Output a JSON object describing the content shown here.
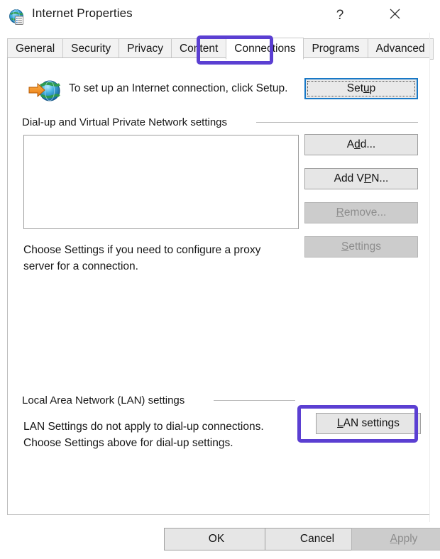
{
  "window": {
    "title": "Internet Properties",
    "icon": "internet-properties-globe-icon",
    "help_label": "?",
    "close_label": "✕"
  },
  "tabs": [
    {
      "label": "General",
      "selected": false
    },
    {
      "label": "Security",
      "selected": false
    },
    {
      "label": "Privacy",
      "selected": false
    },
    {
      "label": "Content",
      "selected": false
    },
    {
      "label": "Connections",
      "selected": true
    },
    {
      "label": "Programs",
      "selected": false
    },
    {
      "label": "Advanced",
      "selected": false
    }
  ],
  "setup_section": {
    "icon": "globe-with-arrow-icon",
    "description": "To set up an Internet connection, click Setup.",
    "button": {
      "label": "Setup",
      "accelerator": "u",
      "prefix": "Set",
      "suffix": "p",
      "enabled": true,
      "focused": true
    }
  },
  "dialup_section": {
    "group_label": "Dial-up and Virtual Private Network settings",
    "list_items": [],
    "buttons": [
      {
        "label": "Add...",
        "prefix": "A",
        "accelerator": "d",
        "suffix": "d...",
        "enabled": true
      },
      {
        "label": "Add VPN...",
        "prefix": "Add V",
        "accelerator": "P",
        "suffix": "N...",
        "enabled": true
      },
      {
        "label": "Remove...",
        "prefix": "",
        "accelerator": "R",
        "suffix": "emove...",
        "enabled": false
      },
      {
        "label": "Settings",
        "prefix": "",
        "accelerator": "S",
        "suffix": "ettings",
        "enabled": false
      }
    ],
    "proxy_note": "Choose Settings if you need to configure a proxy server for a connection."
  },
  "lan_section": {
    "group_label": "Local Area Network (LAN) settings",
    "description": "LAN Settings do not apply to dial-up connections. Choose Settings above for dial-up settings.",
    "button": {
      "label": "LAN settings",
      "prefix": "",
      "accelerator": "L",
      "suffix": "AN settings",
      "enabled": true
    }
  },
  "footer": {
    "ok": {
      "label": "OK",
      "enabled": true
    },
    "cancel": {
      "label": "Cancel",
      "enabled": true
    },
    "apply": {
      "prefix": "",
      "accelerator": "A",
      "suffix": "pply",
      "label": "Apply",
      "enabled": false
    }
  },
  "annotations": {
    "color": "#5b3fd2",
    "highlighted": [
      "Connections tab",
      "LAN settings button"
    ]
  }
}
